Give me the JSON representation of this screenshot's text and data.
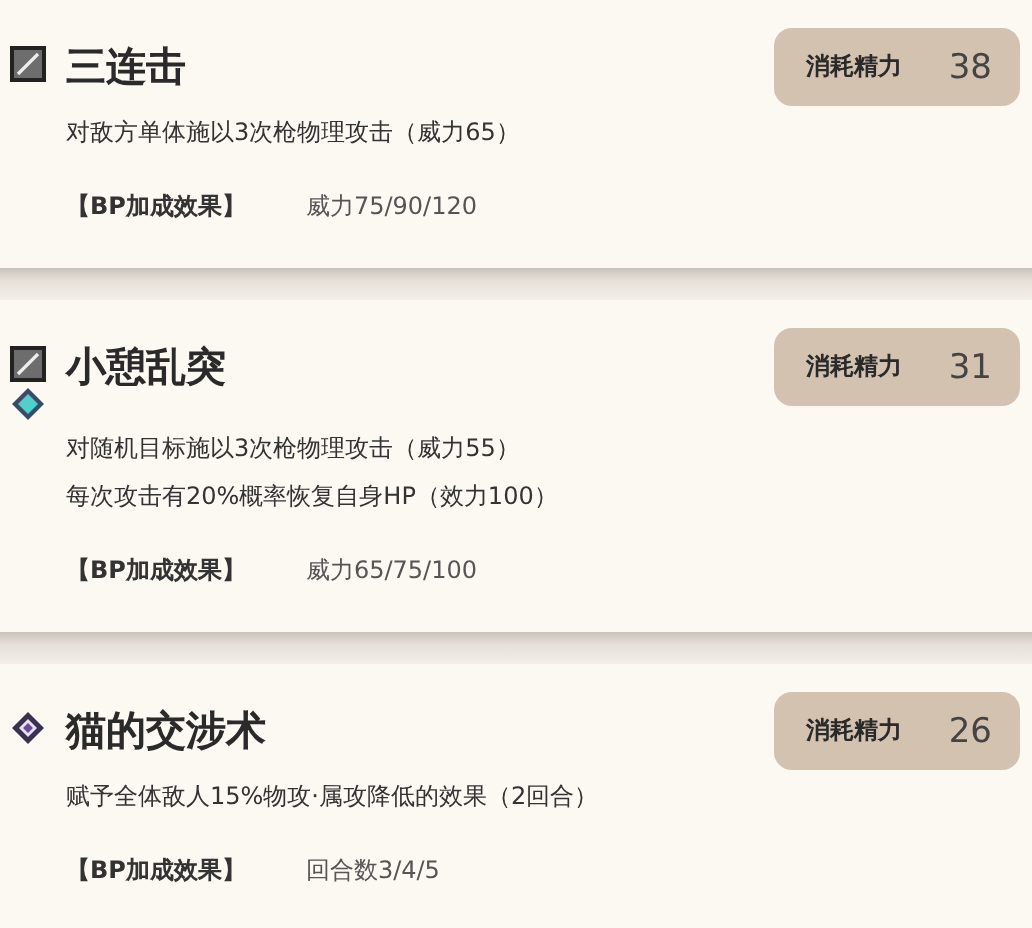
{
  "skills": [
    {
      "name": "三连击",
      "icons": [
        {
          "kind": "spear"
        }
      ],
      "cost_label": "消耗精力",
      "cost": "38",
      "description": [
        "对敌方单体施以3次枪物理攻击（威力65）"
      ],
      "bp_label": "【BP加成效果】",
      "bp_value": "威力75/90/120"
    },
    {
      "name": "小憩乱突",
      "icons": [
        {
          "kind": "spear"
        },
        {
          "kind": "teal-gem"
        }
      ],
      "cost_label": "消耗精力",
      "cost": "31",
      "description": [
        "对随机目标施以3次枪物理攻击（威力55）",
        "每次攻击有20%概率恢复自身HP（效力100）"
      ],
      "bp_label": "【BP加成效果】",
      "bp_value": "威力65/75/100"
    },
    {
      "name": "猫的交涉术",
      "icons": [
        {
          "kind": "purple-gem"
        }
      ],
      "cost_label": "消耗精力",
      "cost": "26",
      "description": [
        "赋予全体敌人15%物攻·属攻降低的效果（2回合）"
      ],
      "bp_label": "【BP加成效果】",
      "bp_value": "回合数3/4/5"
    }
  ]
}
